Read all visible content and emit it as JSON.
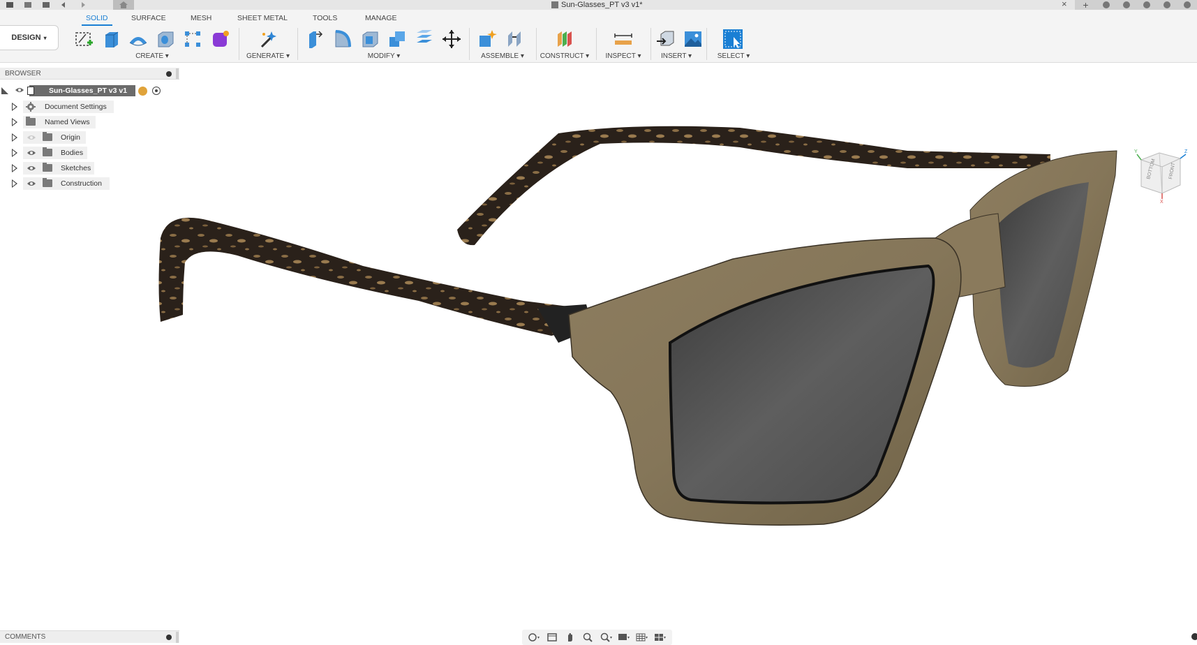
{
  "window": {
    "document_title": "Sun-Glasses_PT v3 v1*",
    "close_glyph": "×",
    "add_tab_glyph": "+"
  },
  "workspace": {
    "label": "DESIGN",
    "caret": "▾"
  },
  "tabs": [
    "SOLID",
    "SURFACE",
    "MESH",
    "SHEET METAL",
    "TOOLS",
    "MANAGE"
  ],
  "active_tab": "SOLID",
  "groups": {
    "create": "CREATE ▾",
    "generate": "GENERATE ▾",
    "modify": "MODIFY ▾",
    "assemble": "ASSEMBLE ▾",
    "construct": "CONSTRUCT ▾",
    "inspect": "INSPECT ▾",
    "insert": "INSERT ▾",
    "select": "SELECT ▾"
  },
  "browser": {
    "title": "BROWSER",
    "root": "Sun-Glasses_PT v3 v1",
    "items": [
      {
        "label": "Document Settings",
        "icon": "gear-icon"
      },
      {
        "label": "Named Views",
        "icon": "folder-icon"
      },
      {
        "label": "Origin",
        "icon": "folder-icon",
        "eye": "hidden"
      },
      {
        "label": "Bodies",
        "icon": "folder-icon",
        "eye": "visible"
      },
      {
        "label": "Sketches",
        "icon": "folder-icon",
        "eye": "visible"
      },
      {
        "label": "Construction",
        "icon": "folder-icon",
        "eye": "visible"
      }
    ]
  },
  "comments": {
    "title": "COMMENTS"
  },
  "viewcube": {
    "faces": [
      "BOTTOM",
      "FRONT"
    ],
    "axes": [
      "X",
      "Y",
      "Z"
    ]
  },
  "colors": {
    "accent": "#1a7fd4",
    "frame_wood": "#857659",
    "temple_tortoise": "#2a211a",
    "lens": "#5a5a5a"
  }
}
